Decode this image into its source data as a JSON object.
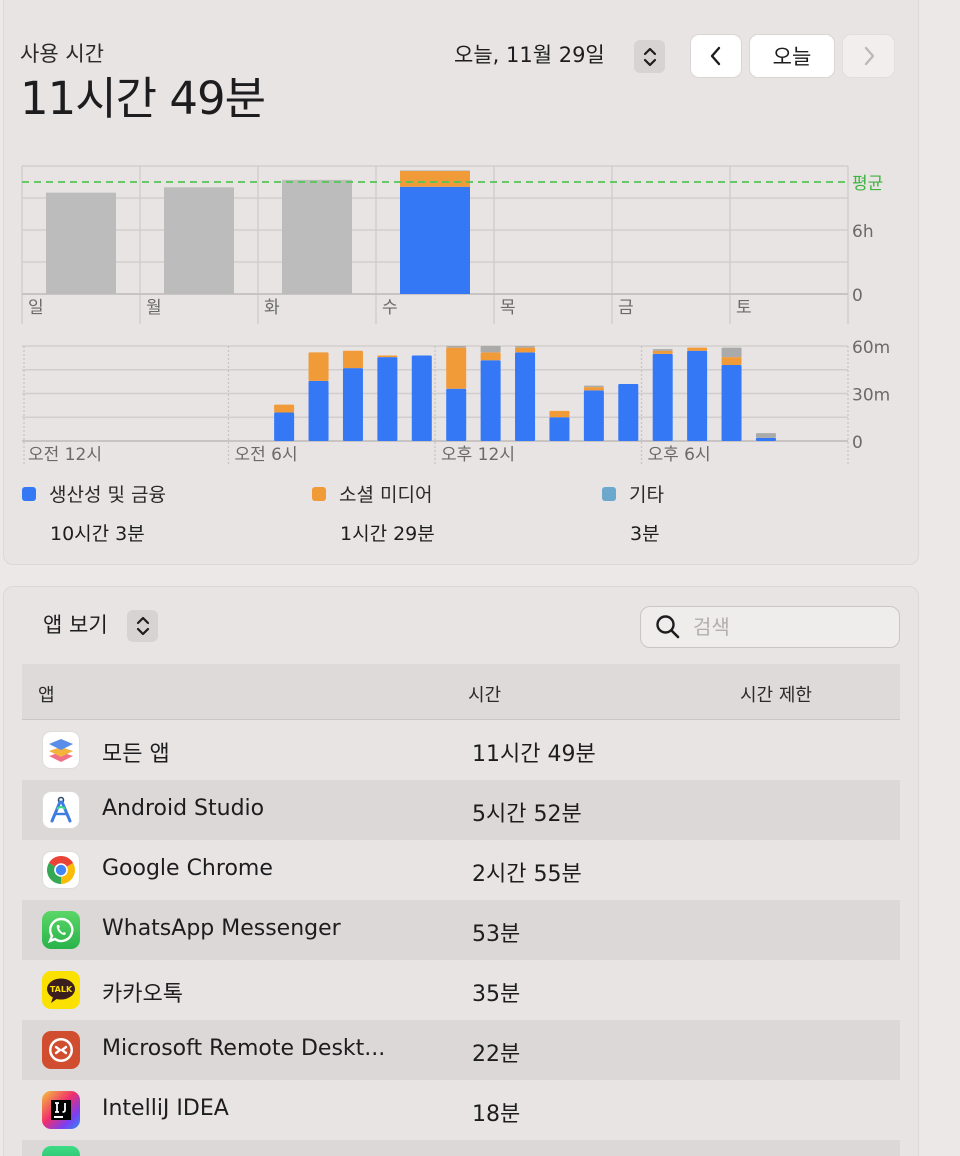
{
  "header": {
    "title": "사용 시간",
    "total": "11시간 49분",
    "date_label": "오늘, 11월 29일",
    "today_button": "오늘"
  },
  "weekly_chart": {
    "days": [
      "일",
      "월",
      "화",
      "수",
      "목",
      "금",
      "토"
    ],
    "y_labels": [
      "평균",
      "6h",
      "0"
    ],
    "avg_label": "평균"
  },
  "hourly_chart": {
    "x_labels": [
      "오전 12시",
      "오전 6시",
      "오후 12시",
      "오후 6시"
    ],
    "y_labels": [
      "60m",
      "30m",
      "0"
    ]
  },
  "chart_data": [
    {
      "type": "bar",
      "stacked": true,
      "categories": [
        "일",
        "월",
        "화",
        "수",
        "목",
        "금",
        "토"
      ],
      "series": [
        {
          "values": [
            9.5,
            10.0,
            10.7,
            10.05,
            0,
            0,
            0
          ]
        },
        {
          "values": [
            0,
            0,
            0,
            1.48,
            0,
            0,
            0
          ]
        },
        {
          "values": [
            0,
            0,
            0,
            0.05,
            0,
            0,
            0
          ]
        }
      ],
      "ylabel": "",
      "ylim": [
        0,
        12
      ],
      "average": 10.5
    },
    {
      "type": "bar",
      "stacked": true,
      "categories": [
        "0",
        "1",
        "2",
        "3",
        "4",
        "5",
        "6",
        "7",
        "8",
        "9",
        "10",
        "11",
        "12",
        "13",
        "14",
        "15",
        "16",
        "17",
        "18",
        "19",
        "20",
        "21",
        "22",
        "23"
      ],
      "series": [
        {
          "values": [
            0,
            0,
            0,
            0,
            0,
            0,
            0,
            18,
            38,
            46,
            53,
            54,
            33,
            51,
            56,
            15,
            32,
            36,
            55,
            57,
            48,
            2,
            0,
            0
          ]
        },
        {
          "values": [
            0,
            0,
            0,
            0,
            0,
            0,
            0,
            5,
            18,
            11,
            1,
            0,
            26,
            5,
            3,
            4,
            2,
            0,
            2,
            2,
            5,
            0,
            0,
            0
          ]
        },
        {
          "values": [
            0,
            0,
            0,
            0,
            0,
            0,
            0,
            0,
            0,
            0,
            0,
            0,
            1,
            4,
            1,
            0,
            1,
            0,
            1,
            0,
            6,
            3,
            0,
            0
          ]
        }
      ],
      "ylim": [
        0,
        60
      ]
    }
  ],
  "legend": [
    {
      "label": "생산성 및 금융",
      "value": "10시간 3분",
      "color": "#3478f6"
    },
    {
      "label": "소셜 미디어",
      "value": "1시간 29분",
      "color": "#f19a38"
    },
    {
      "label": "기타",
      "value": "3분",
      "color": "#6ba8cc"
    }
  ],
  "list": {
    "view_label": "앱 보기",
    "search_placeholder": "검색",
    "columns": {
      "app": "앱",
      "time": "시간",
      "limit": "시간 제한"
    },
    "rows": [
      {
        "name": "모든 앱",
        "time": "11시간 49분"
      },
      {
        "name": "Android Studio",
        "time": "5시간 52분"
      },
      {
        "name": "Google Chrome",
        "time": "2시간 55분"
      },
      {
        "name": "WhatsApp Messenger",
        "time": "53분"
      },
      {
        "name": "카카오톡",
        "time": "35분"
      },
      {
        "name": "Microsoft Remote Deskt...",
        "time": "22분"
      },
      {
        "name": "IntelliJ IDEA",
        "time": "18분"
      }
    ],
    "kakao_icon_text": "TALK"
  }
}
